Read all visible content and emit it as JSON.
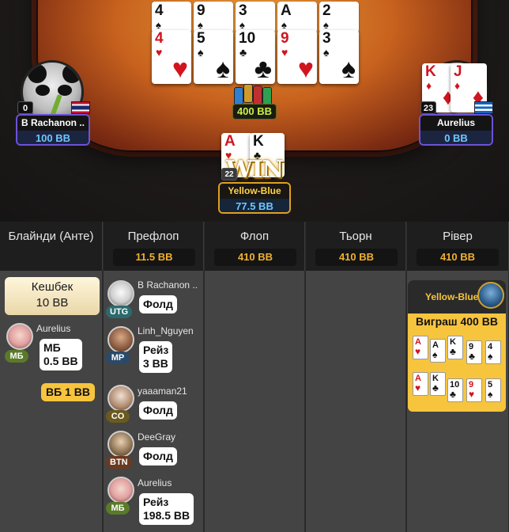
{
  "table": {
    "board_top": [
      {
        "rank": "4",
        "suit": "♠",
        "color": "blk"
      },
      {
        "rank": "9",
        "suit": "♠",
        "color": "blk"
      },
      {
        "rank": "3",
        "suit": "♠",
        "color": "blk"
      },
      {
        "rank": "A",
        "suit": "♠",
        "color": "blk"
      },
      {
        "rank": "2",
        "suit": "♠",
        "color": "blk"
      }
    ],
    "board": [
      {
        "rank": "4",
        "suit": "♥",
        "color": "red"
      },
      {
        "rank": "5",
        "suit": "♠",
        "color": "blk"
      },
      {
        "rank": "10",
        "suit": "♣",
        "color": "blk"
      },
      {
        "rank": "9",
        "suit": "♥",
        "color": "red"
      },
      {
        "rank": "3",
        "suit": "♠",
        "color": "blk"
      }
    ],
    "pot": "400 BB",
    "left_player": {
      "name": "B Rachanon ..",
      "stack": "100 BB",
      "seat": "0"
    },
    "right_player": {
      "name": "Aurelius",
      "stack": "0 BB",
      "seat": "23",
      "cards": [
        {
          "rank": "K",
          "suit": "♦",
          "color": "red"
        },
        {
          "rank": "J",
          "suit": "♦",
          "color": "red"
        }
      ]
    },
    "winner": {
      "name": "Yellow-Blue",
      "stack": "77.5 BB",
      "badge": "WIN",
      "seat": "22",
      "cards": [
        {
          "rank": "A",
          "suit": "♥",
          "color": "red"
        },
        {
          "rank": "K",
          "suit": "♣",
          "color": "blk"
        }
      ]
    }
  },
  "history": {
    "columns": [
      {
        "title": "Блайнди (Анте)",
        "amount": ""
      },
      {
        "title": "Префлоп",
        "amount": "11.5 BB"
      },
      {
        "title": "Флоп",
        "amount": "410 BB"
      },
      {
        "title": "Тьорн",
        "amount": "410 BB"
      },
      {
        "title": "Рівер",
        "amount": "410 BB"
      }
    ],
    "cashback": {
      "title": "Кешбек",
      "amount": "10 BB"
    },
    "blinds": [
      {
        "name": "Aurelius",
        "pos": "МБ",
        "action": "МБ",
        "amount": "0.5 BB"
      },
      {
        "action": "ВБ 1 BB"
      }
    ],
    "preflop": [
      {
        "name": "B Rachanon ..",
        "pos": "UTG",
        "action": "Фолд"
      },
      {
        "name": "Linh_Nguyen",
        "pos": "MP",
        "action": "Рейз",
        "amount": "3 BB"
      },
      {
        "name": "yaaaman21",
        "pos": "CO",
        "action": "Фолд"
      },
      {
        "name": "DeeGray",
        "pos": "BTN",
        "action": "Фолд"
      },
      {
        "name": "Aurelius",
        "pos": "МБ",
        "action": "Рейз",
        "amount": "198.5 BB"
      }
    ],
    "river": {
      "winner": "Yellow-Blue",
      "win_label": "Виграш 400 BB",
      "row1": [
        {
          "rank": "A",
          "suit": "♥",
          "color": "red"
        },
        {
          "rank": "A",
          "suit": "♠",
          "color": "blk"
        },
        {
          "rank": "K",
          "suit": "♣",
          "color": "blk"
        },
        {
          "rank": "9",
          "suit": "♣",
          "color": "blk"
        },
        {
          "rank": "4",
          "suit": "♠",
          "color": "blk"
        }
      ],
      "row2": [
        {
          "rank": "A",
          "suit": "♥",
          "color": "red"
        },
        {
          "rank": "K",
          "suit": "♣",
          "color": "blk"
        },
        {
          "rank": "10",
          "suit": "♣",
          "color": "blk"
        },
        {
          "rank": "9",
          "suit": "♥",
          "color": "red"
        },
        {
          "rank": "5",
          "suit": "♠",
          "color": "blk"
        }
      ]
    }
  }
}
